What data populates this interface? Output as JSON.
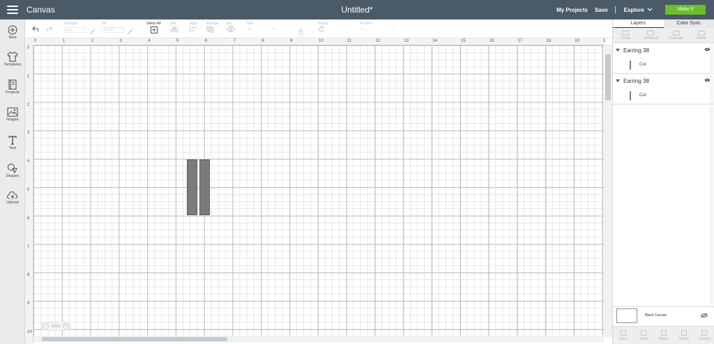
{
  "header": {
    "app_title": "Canvas",
    "document_title": "Untitled*",
    "my_projects": "My Projects",
    "save": "Save",
    "explore": "Explore",
    "make_it": "Make It"
  },
  "sidebar": {
    "items": [
      {
        "label": "New",
        "icon": "plus-circle-icon"
      },
      {
        "label": "Templates",
        "icon": "tshirt-icon"
      },
      {
        "label": "Projects",
        "icon": "projects-book-icon"
      },
      {
        "label": "Images",
        "icon": "image-icon"
      },
      {
        "label": "Text",
        "icon": "text-t-icon"
      },
      {
        "label": "Shapes",
        "icon": "shapes-icon"
      },
      {
        "label": "Upload",
        "icon": "cloud-upload-icon"
      }
    ]
  },
  "toolbar": {
    "linetype_label": "Linetype",
    "linetype_value": "Cut",
    "fill_label": "Fill",
    "fill_value": "No Fill",
    "select_all": "Select All",
    "edit": "Edit",
    "align": "Align",
    "arrange": "Arrange",
    "flip": "Flip",
    "size": "Size",
    "size_w": "W",
    "size_h": "H",
    "rotate": "Rotate",
    "position": "Position",
    "pos_x": "X",
    "pos_y": "Y"
  },
  "canvas": {
    "ruler_top": [
      "0",
      "1",
      "2",
      "3",
      "4",
      "5",
      "6",
      "7",
      "8",
      "9",
      "10",
      "11",
      "12",
      "13",
      "14",
      "15",
      "16",
      "17",
      "18",
      "19",
      "20"
    ],
    "ruler_left": [
      "0",
      "1",
      "2",
      "3",
      "4",
      "5",
      "6",
      "7",
      "8",
      "9",
      "10"
    ],
    "zoom_level": "100%",
    "shape_color": "#7b7b7b"
  },
  "right_panel": {
    "tabs": [
      "Layers",
      "Color Sync"
    ],
    "actions": [
      "Group",
      "UnGroup",
      "Duplicate",
      "Delete"
    ],
    "layers": [
      {
        "name": "Earring 38",
        "child": "Cut"
      },
      {
        "name": "Earring 38",
        "child": "Cut"
      }
    ],
    "blank_canvas": "Blank Canvas",
    "bottom_actions": [
      "Slice",
      "Weld",
      "Attach",
      "Flatten",
      "Contour"
    ]
  },
  "colors": {
    "header_bg": "#4a5a66",
    "make_it_green": "#6bbf2a"
  }
}
